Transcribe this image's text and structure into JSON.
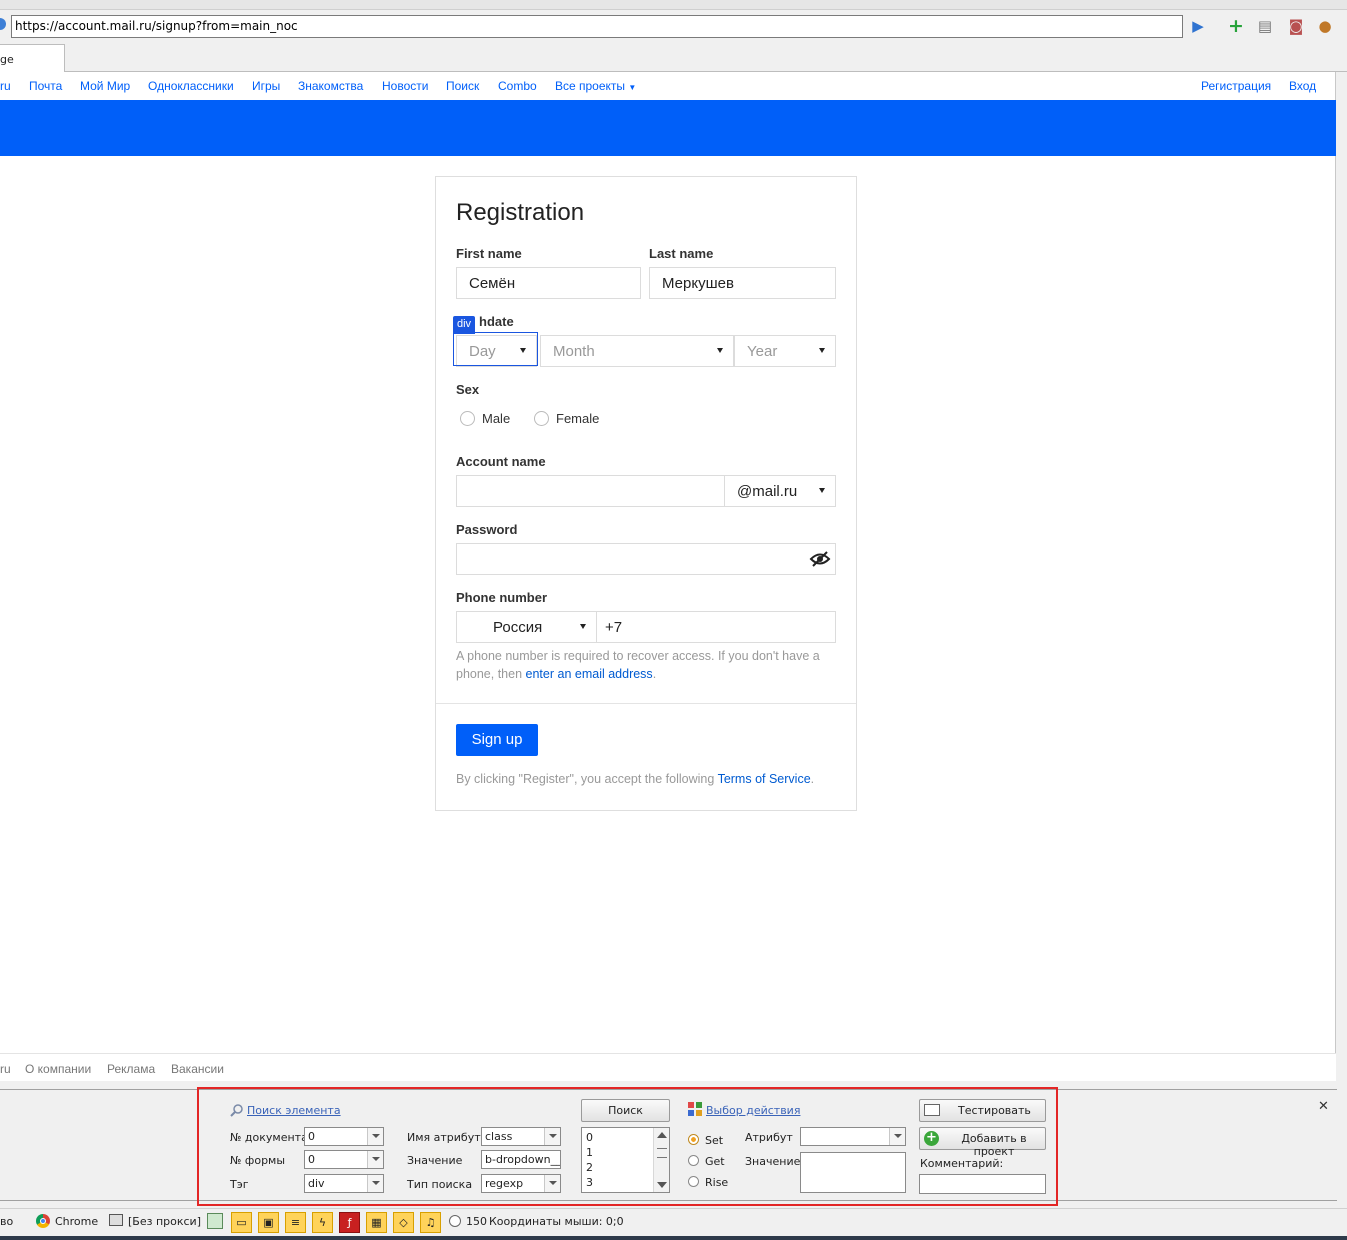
{
  "browser": {
    "url": "https://account.mail.ru/signup?from=main_noc",
    "tab_title": "ge"
  },
  "nav": {
    "left_items": [
      "ru",
      "Почта",
      "Мой Мир",
      "Одноклассники",
      "Игры",
      "Знакомства",
      "Новости",
      "Поиск",
      "Combo",
      "Все проекты"
    ],
    "register": "Регистрация",
    "login": "Вход"
  },
  "form": {
    "title": "Registration",
    "first_name_label": "First name",
    "first_name_value": "Семён",
    "last_name_label": "Last name",
    "last_name_value": "Меркушев",
    "birthdate_label": "hdate",
    "highlight_tag": "div",
    "day_placeholder": "Day",
    "month_placeholder": "Month",
    "year_placeholder": "Year",
    "sex_label": "Sex",
    "male": "Male",
    "female": "Female",
    "account_label": "Account name",
    "domain": "@mail.ru",
    "password_label": "Password",
    "phone_label": "Phone number",
    "country": "Россия",
    "phone_prefix": "+7",
    "phone_hint": "A phone number is required to recover access. If you don't have a phone, then",
    "phone_hint_link": "enter an email address",
    "phone_hint_end": ".",
    "signup_button": "Sign up",
    "terms_text": "By clicking \"Register\", you accept the following",
    "terms_link": "Terms of Service",
    "terms_end": "."
  },
  "footer": {
    "items": [
      "ru",
      "О компании",
      "Реклама",
      "Вакансии"
    ]
  },
  "panel": {
    "search_link": "Поиск элемента",
    "doc_no_label": "№ документа",
    "doc_no_value": "0",
    "form_no_label": "№ формы",
    "form_no_value": "0",
    "tag_label": "Тэг",
    "tag_value": "div",
    "attr_name_label": "Имя атрибута",
    "attr_name_value": "class",
    "value_label": "Значение",
    "value_value": "b-dropdown__c",
    "search_type_label": "Тип поиска",
    "search_type_value": "regexp",
    "search_button": "Поиск",
    "list_items": [
      "0",
      "1",
      "2",
      "3"
    ],
    "action_link": "Выбор действия",
    "set": "Set",
    "get": "Get",
    "rise": "Rise",
    "attribute_label": "Атрибут",
    "attribute_value_label": "Значение",
    "test_button": "Тестировать",
    "add_button": "Добавить в проект",
    "comment_label": "Комментарий:",
    "close": "✕"
  },
  "status": {
    "left": "во",
    "browser": "Chrome",
    "proxy": "[Без прокси]",
    "counter": "150",
    "coords": "Координаты мыши: 0;0"
  },
  "colors": {
    "brand_blue": "#005ff9",
    "highlight_red": "#e32626"
  }
}
